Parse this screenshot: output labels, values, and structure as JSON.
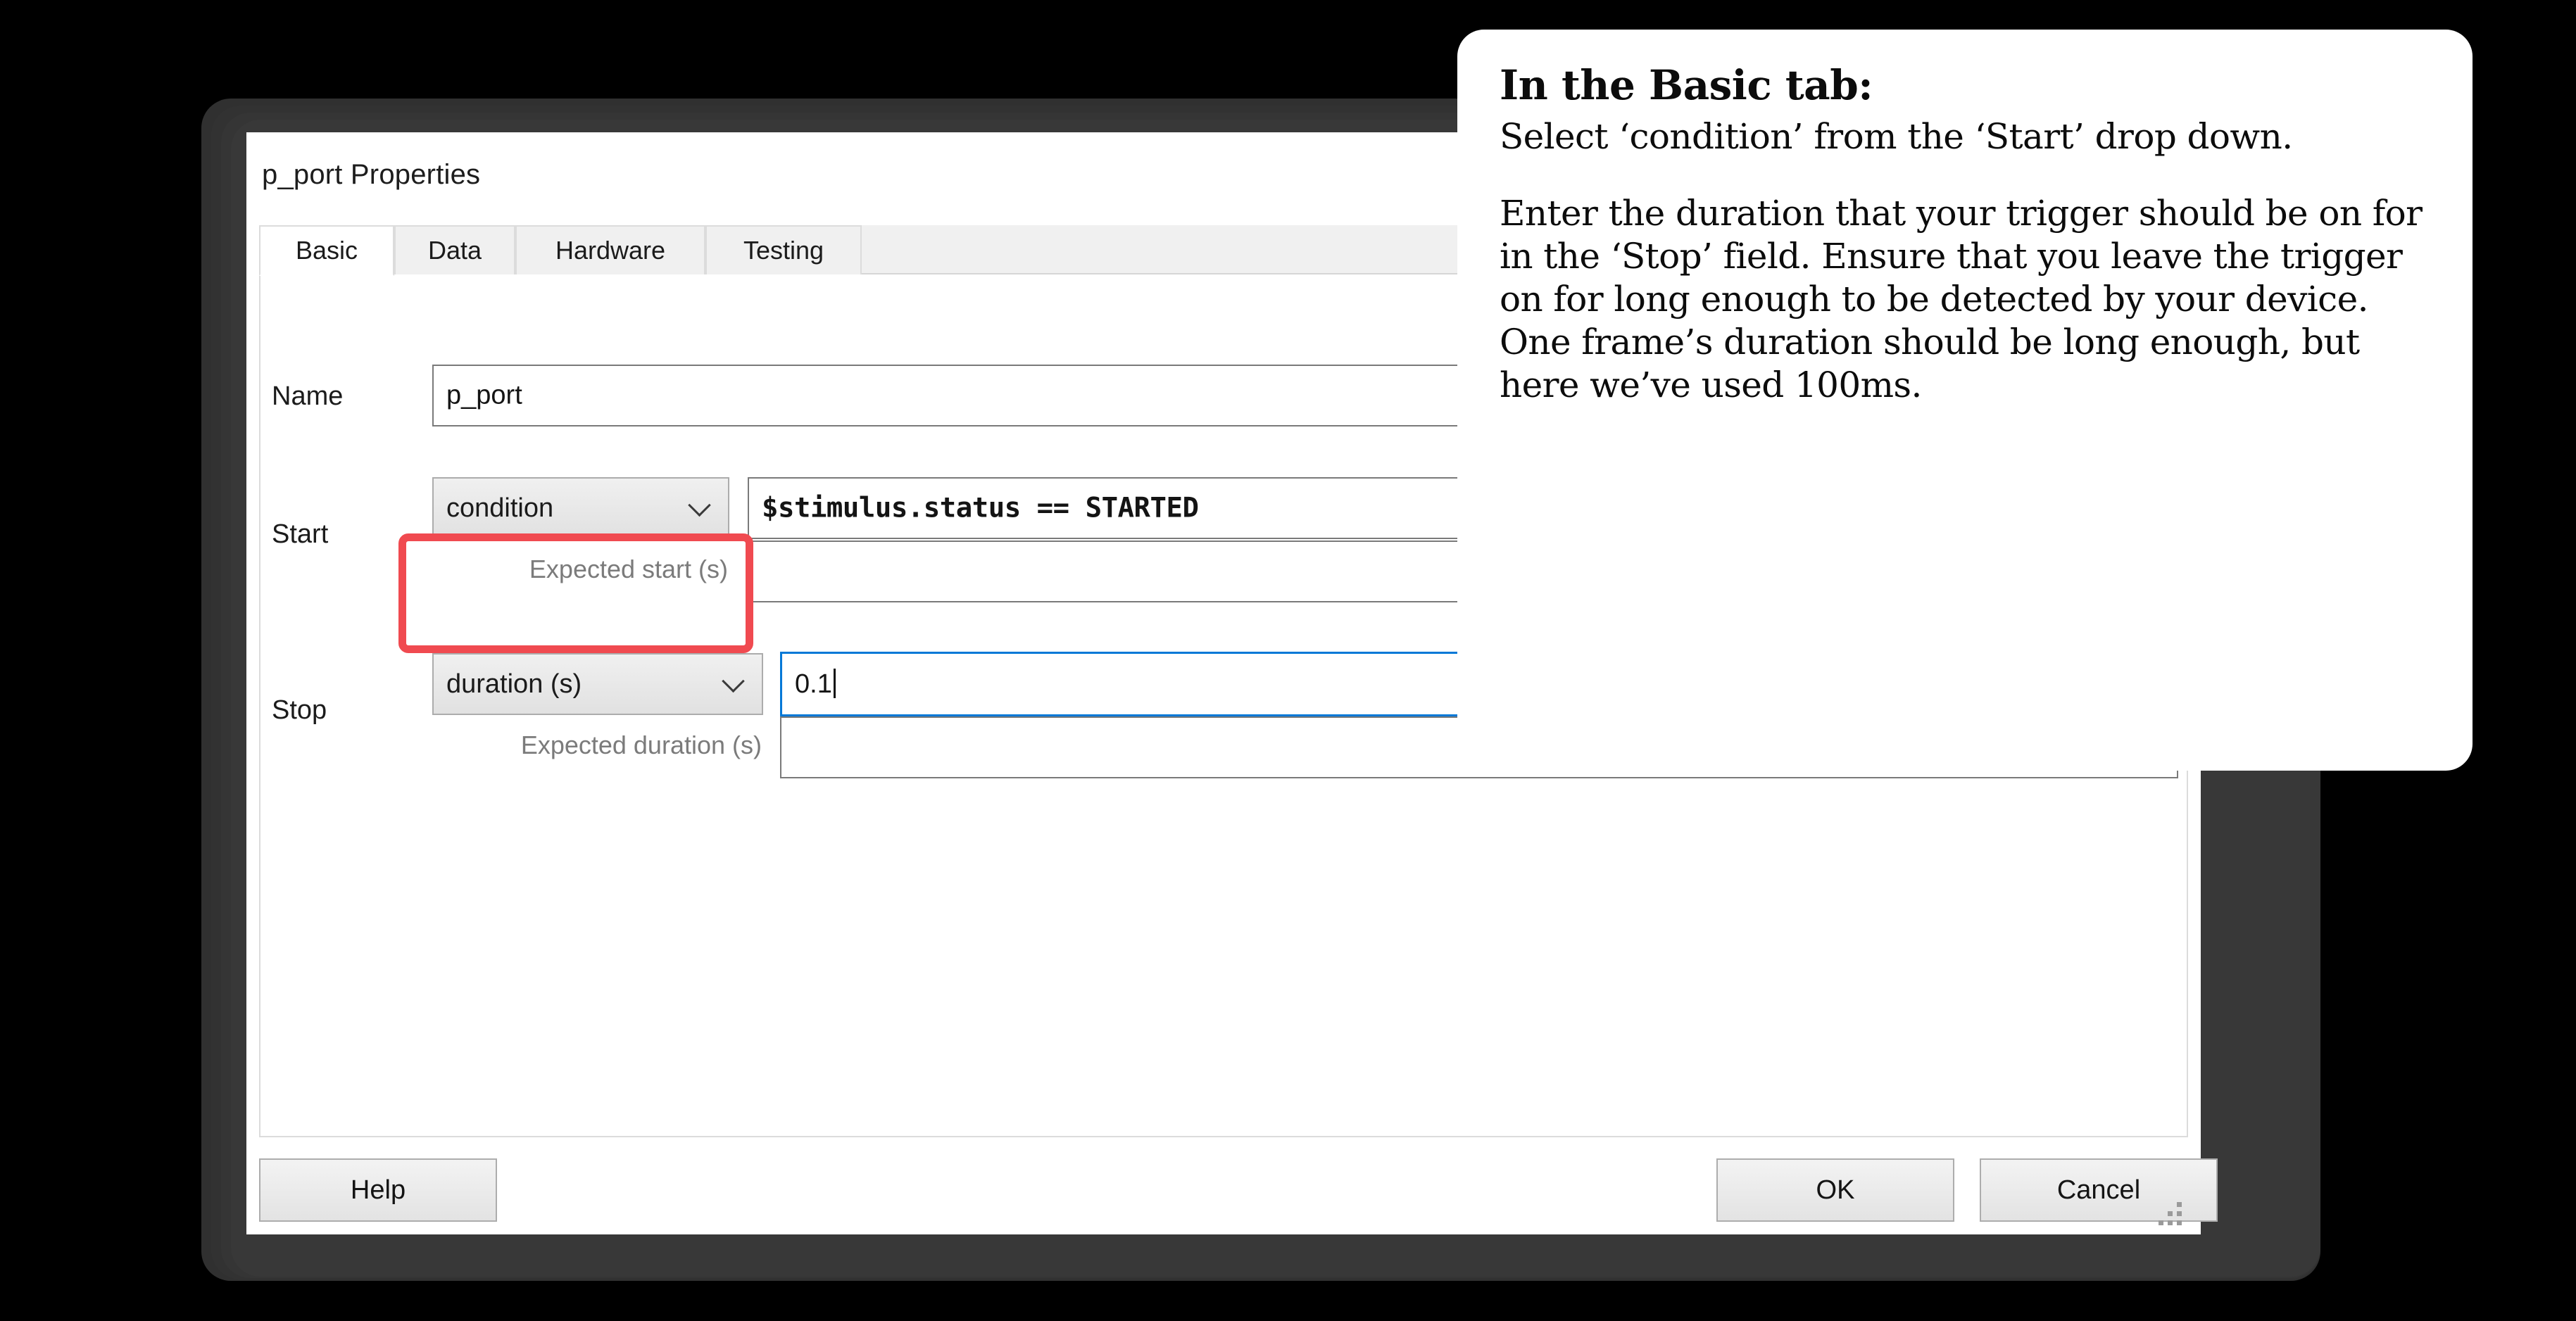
{
  "dialog": {
    "title": "p_port Properties",
    "tabs": [
      {
        "label": "Basic",
        "selected": true
      },
      {
        "label": "Data",
        "selected": false
      },
      {
        "label": "Hardware",
        "selected": false
      },
      {
        "label": "Testing",
        "selected": false
      }
    ],
    "fields": {
      "name": {
        "label": "Name",
        "value": "p_port"
      },
      "start": {
        "label": "Start",
        "mode": "condition",
        "expression": "$stimulus.status == STARTED",
        "expected_label": "Expected start (s)",
        "expected_value": ""
      },
      "stop": {
        "label": "Stop",
        "mode": "duration (s)",
        "value": "0.1",
        "expected_label": "Expected duration (s)",
        "expected_value": ""
      }
    },
    "buttons": {
      "help": "Help",
      "ok": "OK",
      "cancel": "Cancel"
    }
  },
  "callout": {
    "heading": "In the Basic tab:",
    "paragraph1": "Select ‘condition’ from the ‘Start’ drop down.",
    "paragraph2": "Enter the duration that your trigger should be on for in the ‘Stop’ field. Ensure that you leave the trigger on for long enough to be detected by your device. One frame’s duration should be long enough, but here we’ve used 100ms."
  },
  "colors": {
    "highlight": "#f04a50",
    "focus": "#0078d7",
    "background": "#000000",
    "frame": "#303030"
  }
}
